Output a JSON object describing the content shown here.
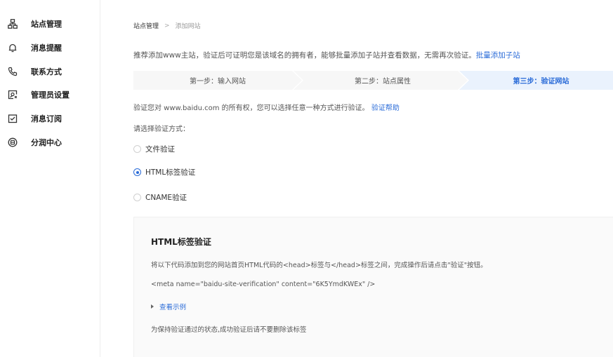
{
  "sidebar": {
    "items": [
      {
        "label": "站点管理",
        "icon": "sitemap-icon"
      },
      {
        "label": "消息提醒",
        "icon": "bell-icon"
      },
      {
        "label": "联系方式",
        "icon": "phone-icon"
      },
      {
        "label": "管理员设置",
        "icon": "admin-settings-icon"
      },
      {
        "label": "消息订阅",
        "icon": "subscribe-icon"
      },
      {
        "label": "分润中心",
        "icon": "revenue-share-icon"
      }
    ]
  },
  "breadcrumb": {
    "root": "站点管理",
    "separator": ">",
    "current": "添加网站"
  },
  "recommend": {
    "text": "推荐添加www主站，验证后可证明您是该域名的拥有者，能够批量添加子站并查看数据，无需再次验证。",
    "link": "批量添加子站"
  },
  "steps": [
    {
      "label": "第一步：输入网站",
      "active": false
    },
    {
      "label": "第二步：站点属性",
      "active": false
    },
    {
      "label": "第三步：验证网站",
      "active": true
    }
  ],
  "verify": {
    "description": "验证您对 www.baidu.com 的所有权，您可以选择任意一种方式进行验证。",
    "help_link": "验证帮助",
    "choose_label": "请选择验证方式："
  },
  "methods": [
    {
      "label": "文件验证",
      "checked": false
    },
    {
      "label": "HTML标签验证",
      "checked": true
    },
    {
      "label": "CNAME验证",
      "checked": false
    }
  ],
  "panel": {
    "title": "HTML标签验证",
    "instruction": "将以下代码添加到您的网站首页HTML代码的<head>标签与</head>标签之间，完成操作后请点击\"验证\"按钮。",
    "code": "<meta name=\"baidu-site-verification\" content=\"6K5YmdKWEx\" />",
    "example_link": "查看示例",
    "keep_note": "为保持验证通过的状态,成功验证后请不要删除该标签"
  },
  "colors": {
    "accent": "#2b6cd8",
    "step_inactive_bg": "#f7f7f7",
    "step_active_bg": "#eaf2fd"
  }
}
